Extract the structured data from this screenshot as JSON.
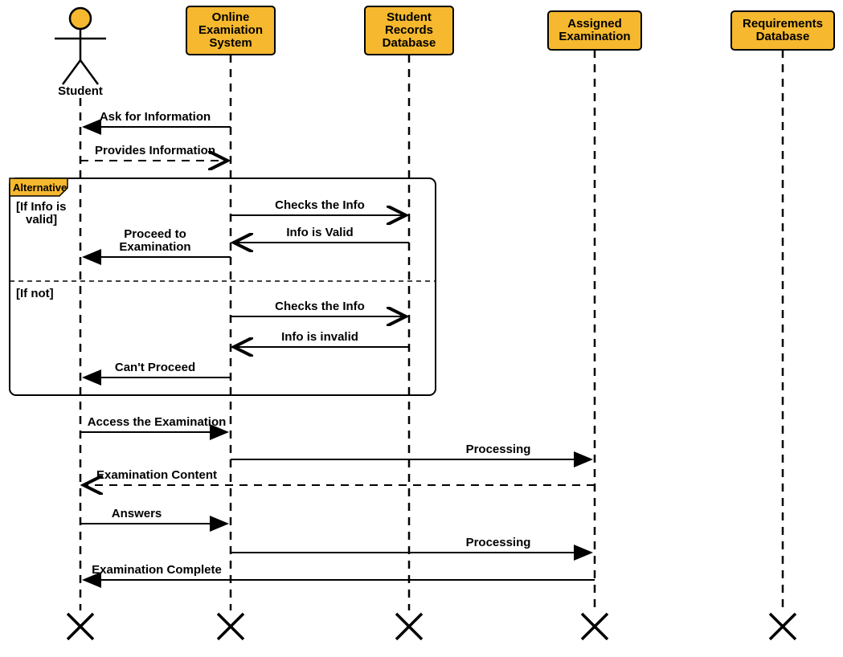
{
  "actor": {
    "label": "Student"
  },
  "participants": {
    "p1": {
      "line1": "Online",
      "line2": "Examiation",
      "line3": "System"
    },
    "p2": {
      "line1": "Student",
      "line2": "Records",
      "line3": "Database"
    },
    "p3": {
      "line1": "Assigned",
      "line2": "Examination"
    },
    "p4": {
      "line1": "Requirements",
      "line2": "Database"
    }
  },
  "alt": {
    "tag": "Alternative",
    "guard1": "[If Info is",
    "guard1b": "valid]",
    "guard2": "[If not]"
  },
  "messages": {
    "m1": "Ask for Information",
    "m2": "Provides Information",
    "m3": "Checks the Info",
    "m4": "Info is Valid",
    "m5a": "Proceed to",
    "m5b": "Examination",
    "m6": "Checks the Info",
    "m7": "Info is invalid",
    "m8": "Can't Proceed",
    "m9": "Access the Examination",
    "m10": "Processing",
    "m11": "Examination Content",
    "m12": "Answers",
    "m13": "Processing",
    "m14": "Examination Complete"
  }
}
